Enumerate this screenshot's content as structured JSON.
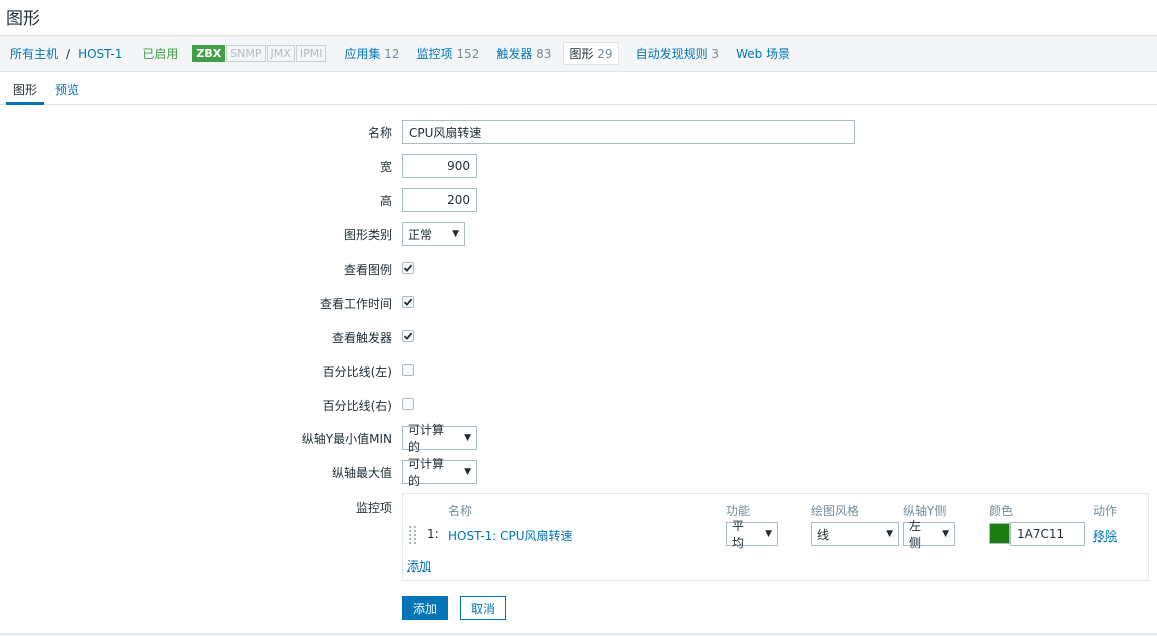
{
  "page": {
    "title": "图形"
  },
  "breadcrumb": {
    "all_hosts": "所有主机",
    "separator": "/",
    "host": "HOST-1",
    "status": "已启用"
  },
  "availability": [
    "ZBX",
    "SNMP",
    "JMX",
    "IPMI"
  ],
  "host_nav": [
    {
      "label": "应用集",
      "count": "12"
    },
    {
      "label": "监控项",
      "count": "152"
    },
    {
      "label": "触发器",
      "count": "83"
    },
    {
      "label": "图形",
      "count": "29"
    },
    {
      "label": "自动发现规则",
      "count": "3"
    },
    {
      "label": "Web 场景",
      "count": ""
    }
  ],
  "tabs": {
    "graph": "图形",
    "preview": "预览"
  },
  "form": {
    "name_label": "名称",
    "name_value": "CPU风扇转速",
    "width_label": "宽",
    "width_value": "900",
    "height_label": "高",
    "height_value": "200",
    "type_label": "图形类别",
    "type_value": "正常",
    "show_legend_label": "查看图例",
    "show_legend": true,
    "show_worktime_label": "查看工作时间",
    "show_worktime": true,
    "show_triggers_label": "查看触发器",
    "show_triggers": true,
    "percent_left_label": "百分比线(左)",
    "percent_left": false,
    "percent_right_label": "百分比线(右)",
    "percent_right": false,
    "ymin_label": "纵轴Y最小值MIN",
    "ymin_value": "可计算的",
    "ymax_label": "纵轴最大值",
    "ymax_value": "可计算的",
    "items_label": "监控项"
  },
  "items_table": {
    "headers": {
      "name": "名称",
      "function": "功能",
      "style": "绘图风格",
      "yaxis": "纵轴Y侧",
      "color": "颜色",
      "action": "动作"
    },
    "rows": [
      {
        "index": "1:",
        "name": "HOST-1: CPU风扇转速",
        "function": "平均",
        "style": "线",
        "yaxis": "左侧",
        "color": "1A7C11",
        "color_hex": "#1A7C11",
        "action": "移除"
      }
    ],
    "add_link": "添加"
  },
  "buttons": {
    "add": "添加",
    "cancel": "取消"
  },
  "colors": {
    "link": "#0275b8",
    "enabled": "#429e47",
    "primary": "#0275b8"
  }
}
